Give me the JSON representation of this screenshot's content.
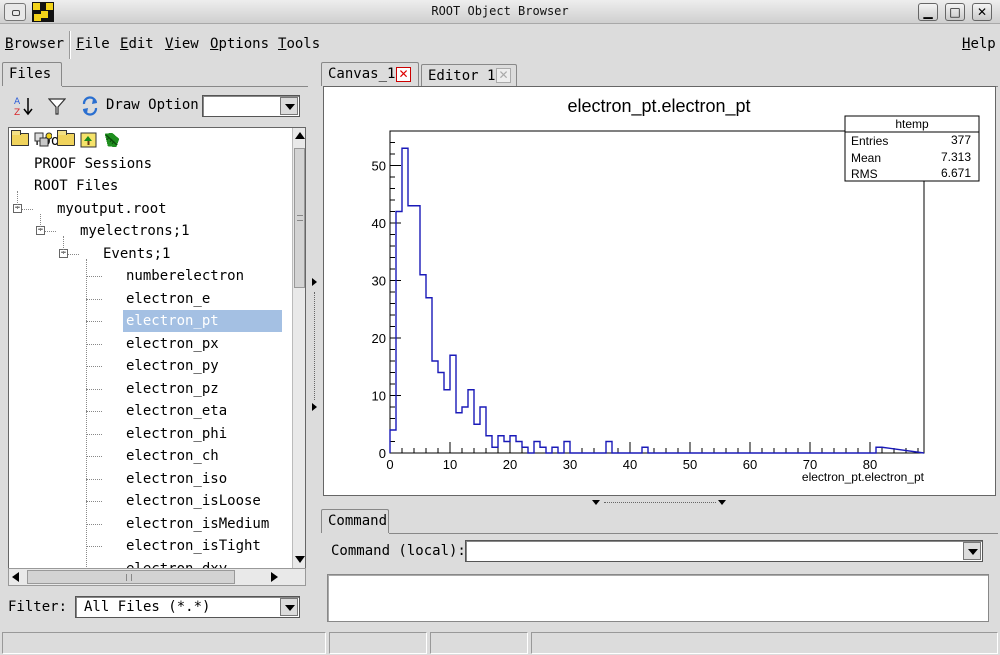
{
  "window": {
    "title": "ROOT Object Browser",
    "minimize_glyph": "▁",
    "maximize_glyph": "□",
    "close_glyph": "✕"
  },
  "menubar": {
    "items": [
      "Browser",
      "File",
      "Edit",
      "View",
      "Options",
      "Tools"
    ],
    "help": "Help"
  },
  "left": {
    "tab_label": "Files",
    "draw_option_label": "Draw Option:",
    "draw_option_value": "",
    "filter_label": "Filter:",
    "filter_value": "All Files (*.*)",
    "tree": [
      {
        "label": "root",
        "icon": "folder-icon",
        "level": 0
      },
      {
        "label": "PROOF Sessions",
        "icon": "folder-icon",
        "level": 0
      },
      {
        "label": "ROOT Files",
        "icon": "folder-open-icon",
        "level": 0
      },
      {
        "label": "myoutput.root",
        "icon": "root-file-icon",
        "level": 1
      },
      {
        "label": "myelectrons;1",
        "icon": "folder-open-icon",
        "level": 2
      },
      {
        "label": "Events;1",
        "icon": "tree-icon",
        "level": 3
      },
      {
        "label": "numberelectron",
        "icon": "leaf-icon",
        "level": 4
      },
      {
        "label": "electron_e",
        "icon": "leaf-icon",
        "level": 4
      },
      {
        "label": "electron_pt",
        "icon": "leaf-icon",
        "level": 4,
        "selected": true
      },
      {
        "label": "electron_px",
        "icon": "leaf-icon",
        "level": 4
      },
      {
        "label": "electron_py",
        "icon": "leaf-icon",
        "level": 4
      },
      {
        "label": "electron_pz",
        "icon": "leaf-icon",
        "level": 4
      },
      {
        "label": "electron_eta",
        "icon": "leaf-icon",
        "level": 4
      },
      {
        "label": "electron_phi",
        "icon": "leaf-icon",
        "level": 4
      },
      {
        "label": "electron_ch",
        "icon": "leaf-icon",
        "level": 4
      },
      {
        "label": "electron_iso",
        "icon": "leaf-icon",
        "level": 4
      },
      {
        "label": "electron_isLoose",
        "icon": "leaf-icon",
        "level": 4
      },
      {
        "label": "electron_isMedium",
        "icon": "leaf-icon",
        "level": 4
      },
      {
        "label": "electron_isTight",
        "icon": "leaf-icon",
        "level": 4
      },
      {
        "label": "electron_dxy",
        "icon": "leaf-icon",
        "level": 4
      }
    ]
  },
  "right": {
    "tabs": [
      {
        "label": "Canvas_1",
        "active": true
      },
      {
        "label": "Editor 1",
        "active": false
      }
    ],
    "command_tab_label": "Command",
    "command_label": "Command (local):",
    "command_value": ""
  },
  "stats": {
    "name": "htemp",
    "entries_label": "Entries",
    "entries": "377",
    "mean_label": "Mean",
    "mean": "7.313",
    "rms_label": "RMS",
    "rms": "6.671"
  },
  "chart_data": {
    "type": "bar",
    "title": "electron_pt.electron_pt",
    "xlabel": "electron_pt.electron_pt",
    "ylabel": "",
    "xlim": [
      0,
      89
    ],
    "ylim": [
      0,
      56
    ],
    "xticks": [
      0,
      10,
      20,
      30,
      40,
      50,
      60,
      70,
      80
    ],
    "yticks": [
      0,
      10,
      20,
      30,
      40,
      50
    ],
    "bin_width": 1,
    "bins": [
      {
        "x": 0,
        "value": 4
      },
      {
        "x": 1,
        "value": 42
      },
      {
        "x": 2,
        "value": 53
      },
      {
        "x": 3,
        "value": 43
      },
      {
        "x": 4,
        "value": 43
      },
      {
        "x": 5,
        "value": 31
      },
      {
        "x": 6,
        "value": 27
      },
      {
        "x": 7,
        "value": 16
      },
      {
        "x": 8,
        "value": 14
      },
      {
        "x": 9,
        "value": 11
      },
      {
        "x": 10,
        "value": 17
      },
      {
        "x": 11,
        "value": 7
      },
      {
        "x": 12,
        "value": 8
      },
      {
        "x": 13,
        "value": 11
      },
      {
        "x": 14,
        "value": 5
      },
      {
        "x": 15,
        "value": 8
      },
      {
        "x": 16,
        "value": 3
      },
      {
        "x": 17,
        "value": 1
      },
      {
        "x": 18,
        "value": 3
      },
      {
        "x": 19,
        "value": 2
      },
      {
        "x": 20,
        "value": 3
      },
      {
        "x": 21,
        "value": 2
      },
      {
        "x": 22,
        "value": 1
      },
      {
        "x": 23,
        "value": 0
      },
      {
        "x": 24,
        "value": 2
      },
      {
        "x": 25,
        "value": 1
      },
      {
        "x": 26,
        "value": 0
      },
      {
        "x": 27,
        "value": 1
      },
      {
        "x": 28,
        "value": 0
      },
      {
        "x": 29,
        "value": 2
      },
      {
        "x": 30,
        "value": 0
      },
      {
        "x": 31,
        "value": 0
      },
      {
        "x": 32,
        "value": 0
      },
      {
        "x": 33,
        "value": 0
      },
      {
        "x": 34,
        "value": 0
      },
      {
        "x": 35,
        "value": 0
      },
      {
        "x": 36,
        "value": 2
      },
      {
        "x": 37,
        "value": 0
      },
      {
        "x": 38,
        "value": 0
      },
      {
        "x": 39,
        "value": 0
      },
      {
        "x": 40,
        "value": 0
      },
      {
        "x": 41,
        "value": 0
      },
      {
        "x": 42,
        "value": 1
      },
      {
        "x": 43,
        "value": 0
      },
      {
        "x": 81,
        "value": 1
      }
    ],
    "color": "#1a1ab8",
    "grid": false
  }
}
